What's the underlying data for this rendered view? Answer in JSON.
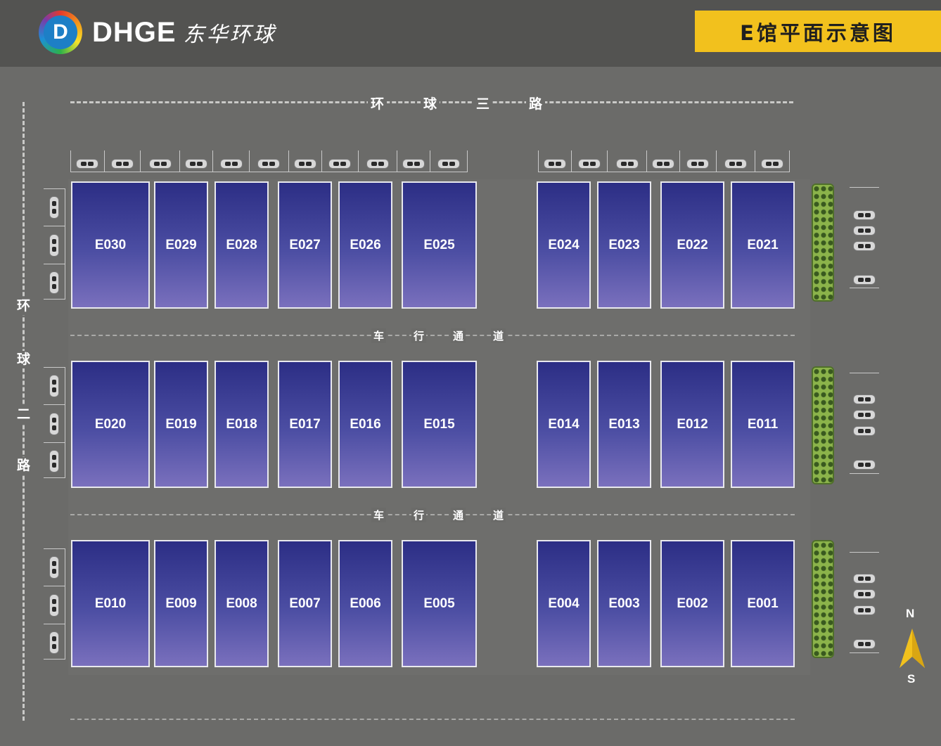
{
  "header": {
    "logo_mark": "D",
    "logo_text": "DHGE",
    "logo_cn": "东华环球",
    "title": "E馆平面示意图"
  },
  "roads": {
    "north_chars": [
      "环",
      "球",
      "三",
      "路"
    ],
    "west_chars": [
      "环",
      "球",
      "二",
      "路"
    ],
    "aisle_chars": [
      "车",
      "行",
      "通",
      "道"
    ]
  },
  "booths": {
    "row1": [
      "E030",
      "E029",
      "E028",
      "E027",
      "E026",
      "E025",
      "E024",
      "E023",
      "E022",
      "E021"
    ],
    "row2": [
      "E020",
      "E019",
      "E018",
      "E017",
      "E016",
      "E015",
      "E014",
      "E013",
      "E012",
      "E011"
    ],
    "row3": [
      "E010",
      "E009",
      "E008",
      "E007",
      "E006",
      "E005",
      "E004",
      "E003",
      "E002",
      "E001"
    ]
  },
  "compass": {
    "north": "N",
    "south": "S"
  },
  "colors": {
    "header_bg": "#535351",
    "title_bg": "#f2c11d",
    "booth_top": "#2c2e85",
    "booth_bottom": "#7a70bd",
    "hedge": "#8bb34a"
  }
}
